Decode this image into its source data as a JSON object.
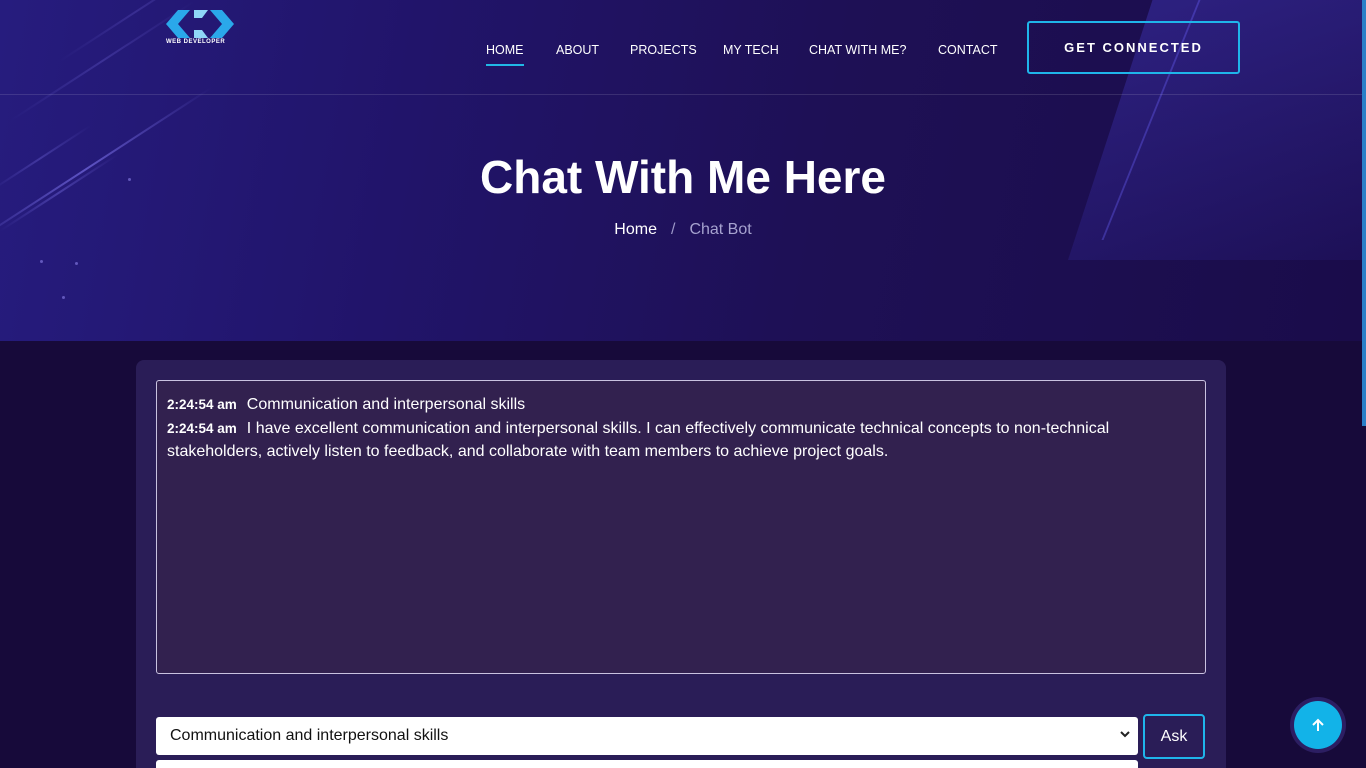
{
  "header": {
    "logo_text": "WEB DEVELOPER",
    "nav": [
      {
        "label": "HOME",
        "active": true
      },
      {
        "label": "ABOUT"
      },
      {
        "label": "PROJECTS"
      },
      {
        "label": "MY TECH"
      },
      {
        "label": "CHAT WITH ME?"
      },
      {
        "label": "CONTACT"
      }
    ],
    "cta_label": "GET CONNECTED"
  },
  "hero": {
    "title": "Chat With Me Here",
    "breadcrumb": {
      "home": "Home",
      "separator": "/",
      "current": "Chat Bot"
    }
  },
  "chat": {
    "messages": [
      {
        "time": "2:24:54 am",
        "text": "Communication and interpersonal skills"
      },
      {
        "time": "2:24:54 am",
        "text": "I have excellent communication and interpersonal skills. I can effectively communicate technical concepts to non-technical stakeholders, actively listen to feedback, and collaborate with team members to achieve project goals."
      }
    ],
    "question_select_value": "Communication and interpersonal skills",
    "ask_label": "Ask"
  },
  "colors": {
    "accent": "#1fb5ea",
    "background": "#170a3a",
    "card": "#2a1d57"
  }
}
